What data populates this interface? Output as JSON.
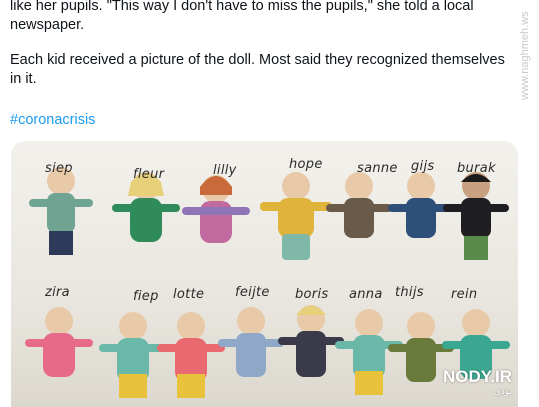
{
  "tweet": {
    "line1": "like her pupils. \"This way I don't have to miss the pupils,\" she told a local",
    "line2": "newspaper.",
    "para2": "Each kid received a picture of the doll. Most said they recognized themselves in it.",
    "hashtag": "#coronacrisis"
  },
  "photo": {
    "row1_names": [
      "siep",
      "fleur",
      "lilly",
      "hope",
      "sanne",
      "gijs",
      "burak"
    ],
    "row2_names": [
      "zira",
      "fiep",
      "lotte",
      "feijte",
      "boris",
      "anna",
      "thijs",
      "rein"
    ]
  },
  "watermarks": {
    "side": "www.naghmeh.ws",
    "corner": "NODY.IR",
    "corner_small": "نودی"
  },
  "colors": {
    "hashtag": "#1d9bf0",
    "text": "#0f1419"
  }
}
